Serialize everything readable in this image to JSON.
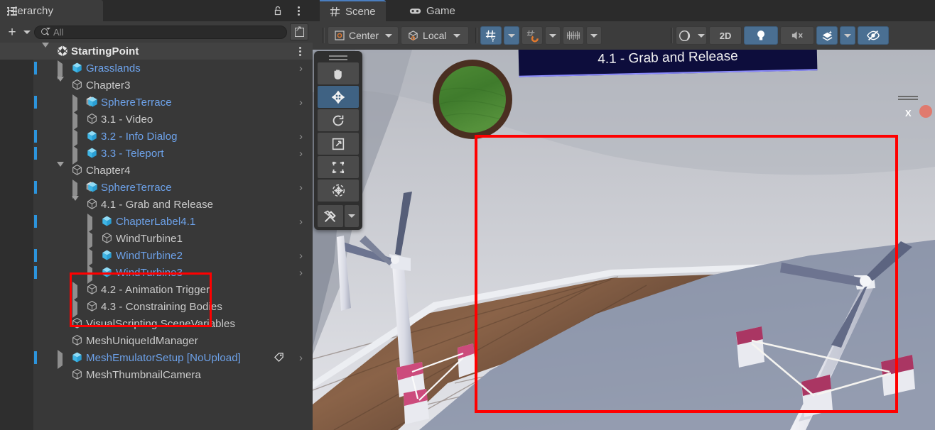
{
  "hierarchy": {
    "tab_label": "Hierarchy",
    "tab_icon": "hierarchy-list-icon",
    "lock_icon": "lock-open-icon",
    "menu_icon": "kebab-menu-icon",
    "toolbar": {
      "add_label": "+",
      "add_dropdown_icon": "chevron-down-icon",
      "search_placeholder": "All",
      "search_value": "",
      "search_icon": "search-icon",
      "expand_icon": "open-in-new-icon"
    },
    "items": [
      {
        "label": "StartingPoint",
        "depth": 0,
        "icon": "unity-logo-icon",
        "foldout": "down",
        "style": "bold",
        "prefab_bar": false,
        "chevron": false,
        "kebab": true
      },
      {
        "label": "Grasslands",
        "depth": 1,
        "icon": "cube-blue-icon",
        "foldout": "right",
        "style": "prefab",
        "prefab_bar": true,
        "chevron": true,
        "kebab": false
      },
      {
        "label": "Chapter3",
        "depth": 1,
        "icon": "cube-outline-icon",
        "foldout": "down",
        "style": "normal",
        "prefab_bar": false,
        "chevron": false,
        "kebab": false
      },
      {
        "label": "SphereTerrace",
        "depth": 2,
        "icon": "cube-striped-icon",
        "foldout": "right",
        "style": "prefab",
        "prefab_bar": true,
        "chevron": true,
        "kebab": false
      },
      {
        "label": "3.1 - Video",
        "depth": 2,
        "icon": "cube-outline-icon",
        "foldout": "right",
        "style": "normal",
        "prefab_bar": false,
        "chevron": false,
        "kebab": false
      },
      {
        "label": "3.2 - Info Dialog",
        "depth": 2,
        "icon": "cube-blue-icon",
        "foldout": "right",
        "style": "prefab",
        "prefab_bar": true,
        "chevron": true,
        "kebab": false
      },
      {
        "label": "3.3 - Teleport",
        "depth": 2,
        "icon": "cube-blue-icon",
        "foldout": "right",
        "style": "prefab",
        "prefab_bar": true,
        "chevron": true,
        "kebab": false
      },
      {
        "label": "Chapter4",
        "depth": 1,
        "icon": "cube-outline-icon",
        "foldout": "down",
        "style": "normal",
        "prefab_bar": false,
        "chevron": false,
        "kebab": false
      },
      {
        "label": "SphereTerrace",
        "depth": 2,
        "icon": "cube-striped-icon",
        "foldout": "right",
        "style": "prefab",
        "prefab_bar": true,
        "chevron": true,
        "kebab": false
      },
      {
        "label": "4.1 - Grab and Release",
        "depth": 2,
        "icon": "cube-outline-icon",
        "foldout": "down",
        "style": "normal",
        "prefab_bar": false,
        "chevron": false,
        "kebab": false
      },
      {
        "label": "ChapterLabel4.1",
        "depth": 3,
        "icon": "cube-blue-icon",
        "foldout": "right",
        "style": "prefab",
        "prefab_bar": true,
        "chevron": true,
        "kebab": false
      },
      {
        "label": "WindTurbine1",
        "depth": 3,
        "icon": "cube-outline-icon",
        "foldout": "right",
        "style": "normal",
        "prefab_bar": false,
        "chevron": false,
        "kebab": false
      },
      {
        "label": "WindTurbine2",
        "depth": 3,
        "icon": "cube-blue-icon",
        "foldout": "right",
        "style": "prefab",
        "prefab_bar": true,
        "chevron": true,
        "kebab": false
      },
      {
        "label": "WindTurbine3",
        "depth": 3,
        "icon": "cube-blue-icon",
        "foldout": "right",
        "style": "prefab",
        "prefab_bar": true,
        "chevron": true,
        "kebab": false
      },
      {
        "label": "4.2 - Animation Trigger",
        "depth": 2,
        "icon": "cube-outline-icon",
        "foldout": "right",
        "style": "normal",
        "prefab_bar": false,
        "chevron": false,
        "kebab": false
      },
      {
        "label": "4.3 - Constraining Bodies",
        "depth": 2,
        "icon": "cube-outline-icon",
        "foldout": "right",
        "style": "normal",
        "prefab_bar": false,
        "chevron": false,
        "kebab": false
      },
      {
        "label": "VisualScripting SceneVariables",
        "depth": 1,
        "icon": "cube-outline-icon",
        "foldout": "none",
        "style": "normal",
        "prefab_bar": false,
        "chevron": false,
        "kebab": false
      },
      {
        "label": "MeshUniqueIdManager",
        "depth": 1,
        "icon": "cube-outline-icon",
        "foldout": "none",
        "style": "normal",
        "prefab_bar": false,
        "chevron": false,
        "kebab": false
      },
      {
        "label": "MeshEmulatorSetup [NoUpload]",
        "depth": 1,
        "icon": "cube-blue-icon",
        "foldout": "right",
        "style": "prefab",
        "prefab_bar": true,
        "chevron": true,
        "kebab": false,
        "tag_icon": "tag-icon"
      },
      {
        "label": "MeshThumbnailCamera",
        "depth": 1,
        "icon": "cube-outline-icon",
        "foldout": "none",
        "style": "normal",
        "prefab_bar": false,
        "chevron": false,
        "kebab": false
      }
    ],
    "highlight": {
      "color": "#ff0000",
      "rows": [
        "WindTurbine1",
        "WindTurbine2",
        "WindTurbine3"
      ]
    }
  },
  "scene_panel": {
    "tabs": [
      {
        "label": "Scene",
        "icon": "grid-hash-icon",
        "active": true
      },
      {
        "label": "Game",
        "icon": "gamepad-icon",
        "active": false
      }
    ],
    "toolbar": {
      "pivot_mode": {
        "label": "Center",
        "icon": "pivot-center-icon",
        "dropdown_icon": "chevron-down-icon"
      },
      "handle_space": {
        "label": "Local",
        "icon": "cube-local-icon",
        "dropdown_icon": "chevron-down-icon"
      },
      "grid_snapping": {
        "icon": "grid-snap-icon",
        "active": true,
        "dropdown_icon": "chevron-down-icon"
      },
      "vertex_snapping": {
        "icon": "magnet-snap-icon",
        "active": false,
        "dropdown_icon": "chevron-down-icon"
      },
      "grid_visibility": {
        "icon": "grid-axis-icon",
        "active": false,
        "dropdown_icon": "chevron-down-icon"
      },
      "draw_mode": {
        "icon": "shaded-sphere-icon",
        "dropdown_icon": "chevron-down-icon"
      },
      "view_2d": {
        "label": "2D",
        "active": false
      },
      "lighting": {
        "icon": "light-bulb-icon",
        "active": true
      },
      "audio": {
        "icon": "speaker-mute-icon",
        "active": false
      },
      "effects": {
        "icon": "fx-sparkle-icon",
        "active": true,
        "dropdown_icon": "chevron-down-icon"
      },
      "hidden_objects": {
        "icon": "eye-off-icon",
        "active": true
      }
    },
    "tools_palette": [
      {
        "name": "hand-tool",
        "icon": "hand-icon",
        "active": false
      },
      {
        "name": "move-tool",
        "icon": "move-arrows-icon",
        "active": true
      },
      {
        "name": "rotate-tool",
        "icon": "rotate-icon",
        "active": false
      },
      {
        "name": "scale-tool",
        "icon": "scale-icon",
        "active": false
      },
      {
        "name": "rect-tool",
        "icon": "rect-transform-icon",
        "active": false
      },
      {
        "name": "transform-tool",
        "icon": "transform-combined-icon",
        "active": false
      },
      {
        "name": "custom-tools",
        "icon": "wrench-screwdriver-icon",
        "active": false
      }
    ],
    "scene_banner_text": "4.1 - Grab and Release",
    "scene_gizmo": {
      "axis_label": "X"
    },
    "highlight": {
      "color": "#ff0000"
    }
  }
}
